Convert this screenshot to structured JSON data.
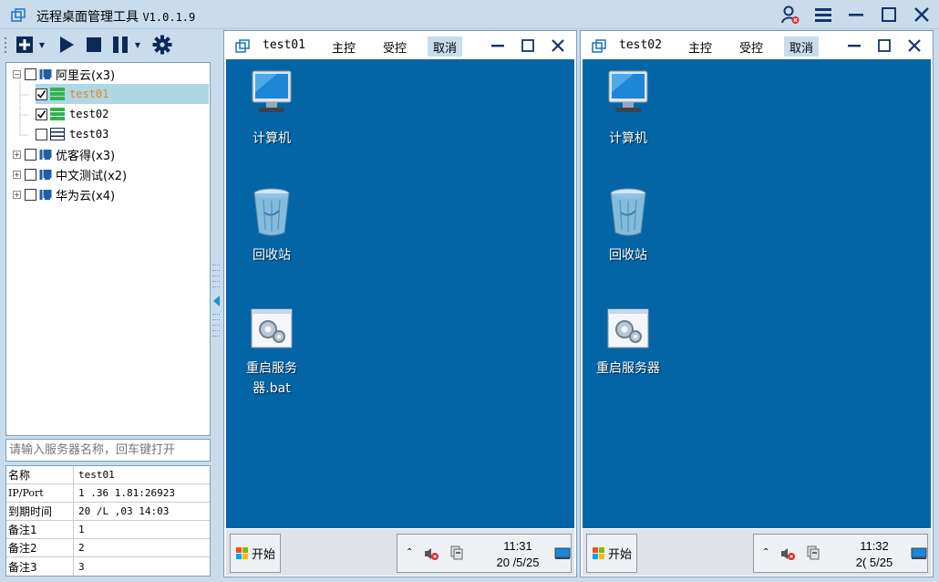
{
  "app": {
    "title": "远程桌面管理工具",
    "version": "V1.0.1.9"
  },
  "colors": {
    "chrome": "#c9dcec",
    "panel_border": "#7a9ebf",
    "desktop": "#0465a6",
    "selected_row": "#b0d7e6",
    "selected_text": "#e8851b",
    "server_on": "#2fb44a"
  },
  "toolbar": {
    "buttons": [
      "add-icon",
      "play-icon",
      "stop-icon",
      "pause-icon",
      "gear-icon"
    ]
  },
  "tree": {
    "groups": [
      {
        "label": "阿里云(x3)",
        "expanded": true,
        "checked": false,
        "children": [
          {
            "label": "test01",
            "checked": true,
            "selected": true,
            "status": "on"
          },
          {
            "label": "test02",
            "checked": true,
            "selected": false,
            "status": "on"
          },
          {
            "label": "test03",
            "checked": false,
            "selected": false,
            "status": "off"
          }
        ]
      },
      {
        "label": "优客得(x3)",
        "expanded": false,
        "checked": false
      },
      {
        "label": "中文测试(x2)",
        "expanded": false,
        "checked": false
      },
      {
        "label": "华为云(x4)",
        "expanded": false,
        "checked": false
      }
    ]
  },
  "search": {
    "placeholder": "请输入服务器名称，回车键打开"
  },
  "info": {
    "rows": [
      {
        "key": "名称",
        "value": "test01"
      },
      {
        "key": "IP/Port",
        "value": "1   .36   1.81:26923"
      },
      {
        "key": "到期时间",
        "value": "20   /L  ,03 14:03"
      },
      {
        "key": "备注1",
        "value": "1"
      },
      {
        "key": "备注2",
        "value": "2"
      },
      {
        "key": "备注3",
        "value": "3"
      }
    ]
  },
  "sessions": [
    {
      "title": "test01",
      "actions": [
        "主控",
        "受控",
        "取消"
      ],
      "active_action": "取消",
      "desktop_icons": [
        {
          "label": "计算机",
          "icon": "computer-icon"
        },
        {
          "label": "回收站",
          "icon": "recycle-bin-icon"
        },
        {
          "label": "重启服务器.bat",
          "icon": "batch-file-icon"
        }
      ],
      "start_label": "开始",
      "clock_time": "11:31",
      "clock_date": "20    /5/25"
    },
    {
      "title": "test02",
      "actions": [
        "主控",
        "受控",
        "取消"
      ],
      "active_action": "取消",
      "desktop_icons": [
        {
          "label": "计算机",
          "icon": "computer-icon"
        },
        {
          "label": "回收站",
          "icon": "recycle-bin-icon"
        },
        {
          "label": "重启服务器",
          "icon": "batch-file-icon"
        }
      ],
      "start_label": "开始",
      "clock_time": "11:32",
      "clock_date": "2(    5/25"
    }
  ]
}
